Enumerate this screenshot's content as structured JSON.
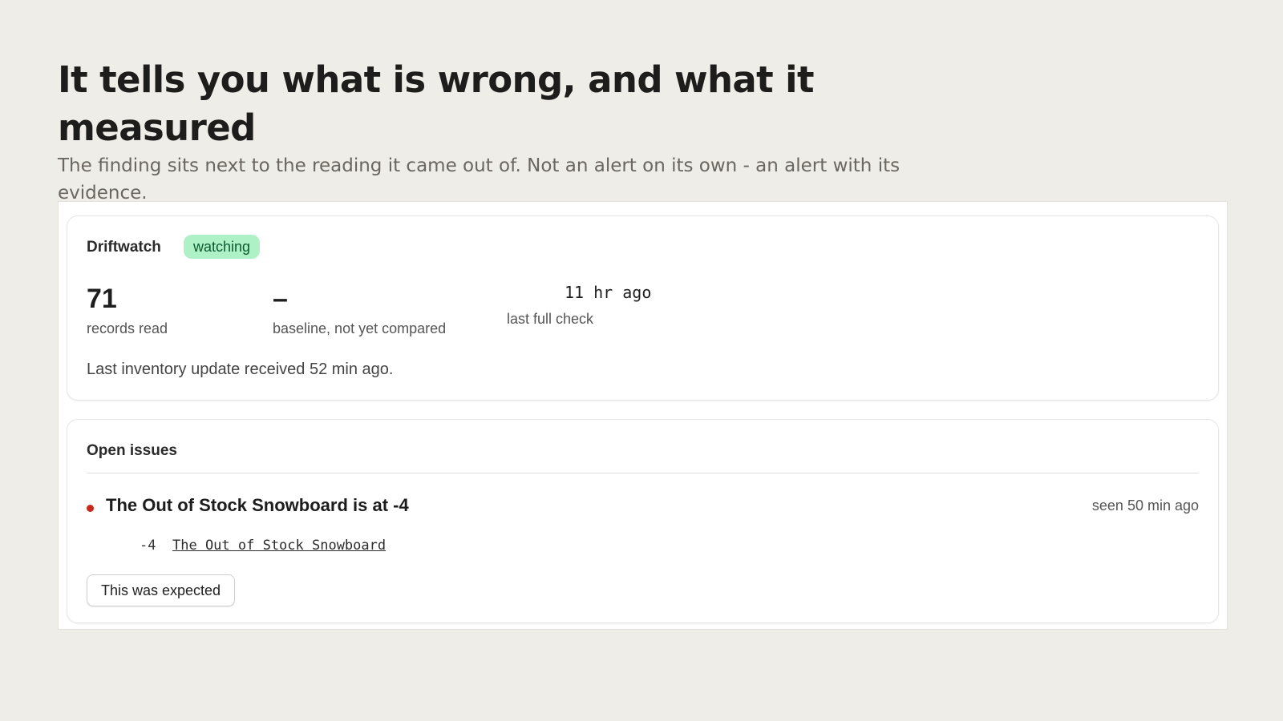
{
  "hero": {
    "title": "It tells you what is wrong, and what it measured",
    "subtitle": "The finding sits next to the reading it came out of. Not an alert on its own - an alert with its evidence."
  },
  "status_card": {
    "app_name": "Driftwatch",
    "badge": "watching",
    "metrics": [
      {
        "value": "71",
        "label": "records read"
      },
      {
        "value": "–",
        "label": "baseline, not yet compared"
      },
      {
        "value": "11 hr ago",
        "label": "last full check"
      }
    ],
    "status_line": "Last inventory update received 52 min ago."
  },
  "issues_card": {
    "title": "Open issues",
    "issue": {
      "title": "The Out of Stock Snowboard is at -4",
      "seen": "seen 50 min ago",
      "evidence_value": "-4",
      "evidence_link": "The Out of Stock Snowboard"
    },
    "action_label": "This was expected"
  },
  "colors": {
    "background": "#efede8",
    "badge_bg": "#aef1c6",
    "badge_text": "#0c5a32",
    "issue_dot": "#c8281d"
  }
}
